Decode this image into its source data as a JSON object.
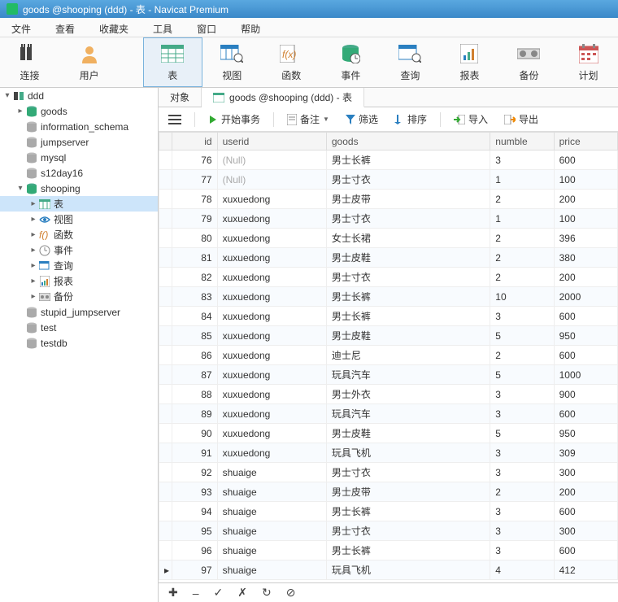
{
  "titlebar": {
    "text": "goods @shooping (ddd) - 表 - Navicat Premium"
  },
  "menu": {
    "file": "文件",
    "view": "查看",
    "fav": "收藏夹",
    "tools": "工具",
    "window": "窗口",
    "help": "帮助"
  },
  "toolbar": {
    "connect": "连接",
    "user": "用户",
    "table": "表",
    "viewbtn": "视图",
    "func": "函数",
    "event": "事件",
    "query": "查询",
    "report": "报表",
    "backup": "备份",
    "plan": "计划"
  },
  "tree": [
    {
      "depth": 0,
      "icon": "connection",
      "label": "ddd",
      "toggle": "▾"
    },
    {
      "depth": 1,
      "icon": "db",
      "label": "goods",
      "toggle": "▸"
    },
    {
      "depth": 1,
      "icon": "db-grey",
      "label": "information_schema",
      "toggle": ""
    },
    {
      "depth": 1,
      "icon": "db-grey",
      "label": "jumpserver",
      "toggle": ""
    },
    {
      "depth": 1,
      "icon": "db-grey",
      "label": "mysql",
      "toggle": ""
    },
    {
      "depth": 1,
      "icon": "db-grey",
      "label": "s12day16",
      "toggle": ""
    },
    {
      "depth": 1,
      "icon": "db",
      "label": "shooping",
      "toggle": "▾"
    },
    {
      "depth": 2,
      "icon": "table",
      "label": "表",
      "toggle": "▸",
      "selected": true
    },
    {
      "depth": 2,
      "icon": "view",
      "label": "视图",
      "toggle": "▸"
    },
    {
      "depth": 2,
      "icon": "func",
      "label": "函数",
      "toggle": "▸"
    },
    {
      "depth": 2,
      "icon": "event",
      "label": "事件",
      "toggle": "▸"
    },
    {
      "depth": 2,
      "icon": "query",
      "label": "查询",
      "toggle": "▸"
    },
    {
      "depth": 2,
      "icon": "report",
      "label": "报表",
      "toggle": "▸"
    },
    {
      "depth": 2,
      "icon": "backup",
      "label": "备份",
      "toggle": "▸"
    },
    {
      "depth": 1,
      "icon": "db-grey",
      "label": "stupid_jumpserver",
      "toggle": ""
    },
    {
      "depth": 1,
      "icon": "db-grey",
      "label": "test",
      "toggle": ""
    },
    {
      "depth": 1,
      "icon": "db-grey",
      "label": "testdb",
      "toggle": ""
    }
  ],
  "tabs": {
    "objects": "对象",
    "active": "goods @shooping (ddd) - 表"
  },
  "actions": {
    "begin_trans": "开始事务",
    "memo": "备注",
    "filter": "筛选",
    "sort": "排序",
    "import": "导入",
    "export": "导出"
  },
  "columns": {
    "id": "id",
    "userid": "userid",
    "goods": "goods",
    "numble": "numble",
    "price": "price"
  },
  "rows": [
    {
      "id": 76,
      "userid": null,
      "goods": "男士长裤",
      "numble": 3,
      "price": 600
    },
    {
      "id": 77,
      "userid": null,
      "goods": "男士寸衣",
      "numble": 1,
      "price": 100
    },
    {
      "id": 78,
      "userid": "xuxuedong",
      "goods": "男士皮带",
      "numble": 2,
      "price": 200
    },
    {
      "id": 79,
      "userid": "xuxuedong",
      "goods": "男士寸衣",
      "numble": 1,
      "price": 100
    },
    {
      "id": 80,
      "userid": "xuxuedong",
      "goods": "女士长裙",
      "numble": 2,
      "price": 396
    },
    {
      "id": 81,
      "userid": "xuxuedong",
      "goods": "男士皮鞋",
      "numble": 2,
      "price": 380
    },
    {
      "id": 82,
      "userid": "xuxuedong",
      "goods": "男士寸衣",
      "numble": 2,
      "price": 200
    },
    {
      "id": 83,
      "userid": "xuxuedong",
      "goods": "男士长裤",
      "numble": 10,
      "price": 2000
    },
    {
      "id": 84,
      "userid": "xuxuedong",
      "goods": "男士长裤",
      "numble": 3,
      "price": 600
    },
    {
      "id": 85,
      "userid": "xuxuedong",
      "goods": "男士皮鞋",
      "numble": 5,
      "price": 950
    },
    {
      "id": 86,
      "userid": "xuxuedong",
      "goods": "迪士尼",
      "numble": 2,
      "price": 600
    },
    {
      "id": 87,
      "userid": "xuxuedong",
      "goods": "玩具汽车",
      "numble": 5,
      "price": 1000
    },
    {
      "id": 88,
      "userid": "xuxuedong",
      "goods": "男士外衣",
      "numble": 3,
      "price": 900
    },
    {
      "id": 89,
      "userid": "xuxuedong",
      "goods": "玩具汽车",
      "numble": 3,
      "price": 600
    },
    {
      "id": 90,
      "userid": "xuxuedong",
      "goods": "男士皮鞋",
      "numble": 5,
      "price": 950
    },
    {
      "id": 91,
      "userid": "xuxuedong",
      "goods": "玩具飞机",
      "numble": 3,
      "price": 309
    },
    {
      "id": 92,
      "userid": "shuaige",
      "goods": "男士寸衣",
      "numble": 3,
      "price": 300
    },
    {
      "id": 93,
      "userid": "shuaige",
      "goods": "男士皮带",
      "numble": 2,
      "price": 200
    },
    {
      "id": 94,
      "userid": "shuaige",
      "goods": "男士长裤",
      "numble": 3,
      "price": 600
    },
    {
      "id": 95,
      "userid": "shuaige",
      "goods": "男士寸衣",
      "numble": 3,
      "price": 300
    },
    {
      "id": 96,
      "userid": "shuaige",
      "goods": "男士长裤",
      "numble": 3,
      "price": 600
    },
    {
      "id": 97,
      "userid": "shuaige",
      "goods": "玩具飞机",
      "numble": 4,
      "price": 412
    }
  ],
  "null_text": "(Null)",
  "active_row_id": 97
}
